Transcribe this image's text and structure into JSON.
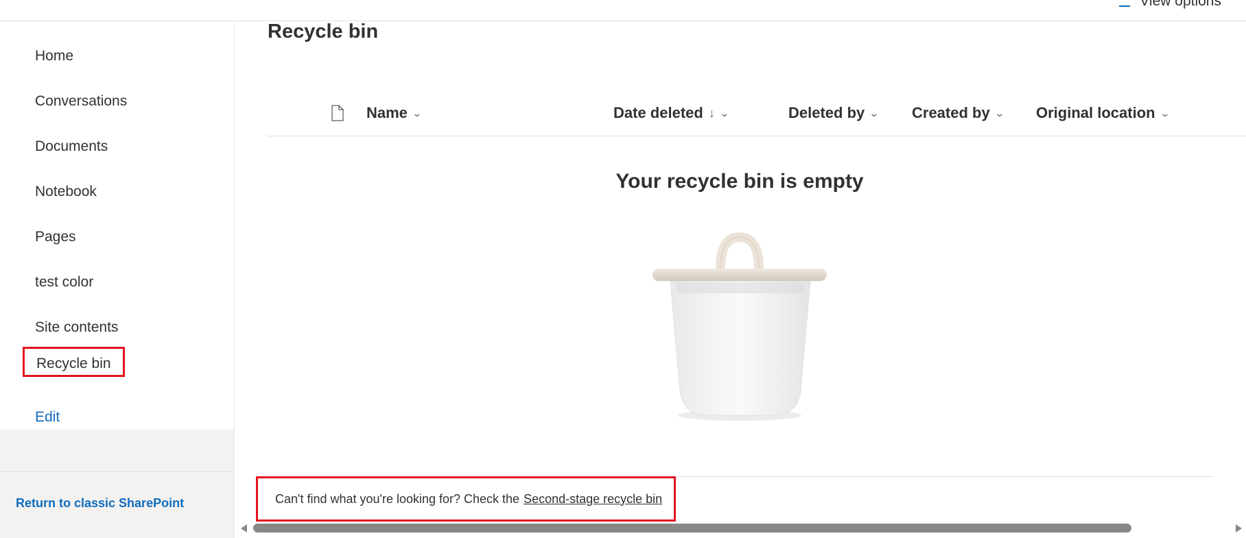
{
  "header": {
    "view_options_label": "View options"
  },
  "sidebar": {
    "items": [
      {
        "label": "Home"
      },
      {
        "label": "Conversations"
      },
      {
        "label": "Documents"
      },
      {
        "label": "Notebook"
      },
      {
        "label": "Pages"
      },
      {
        "label": "test color"
      },
      {
        "label": "Site contents"
      },
      {
        "label": "Recycle bin"
      }
    ],
    "edit_label": "Edit",
    "return_label": "Return to classic SharePoint"
  },
  "main": {
    "title": "Recycle bin",
    "columns": [
      {
        "label": "Name"
      },
      {
        "label": "Date deleted",
        "sort": "descending"
      },
      {
        "label": "Deleted by"
      },
      {
        "label": "Created by"
      },
      {
        "label": "Original location"
      }
    ],
    "empty_message": "Your recycle bin is empty",
    "footer_prefix": "Can't find what you're looking for? Check the",
    "second_stage_link": "Second-stage recycle bin"
  },
  "colors": {
    "accent": "#0f6cbd",
    "highlight_box": "#e3131f",
    "text": "#323130",
    "sidebar_lower_bg": "#f3f2f1"
  },
  "icons": {
    "view_options": "view-options-icon",
    "file_type": "file-icon",
    "sort": "arrow-down-icon",
    "column_menu": "chevron-down-icon",
    "empty_state": "trash-bin-illustration"
  }
}
